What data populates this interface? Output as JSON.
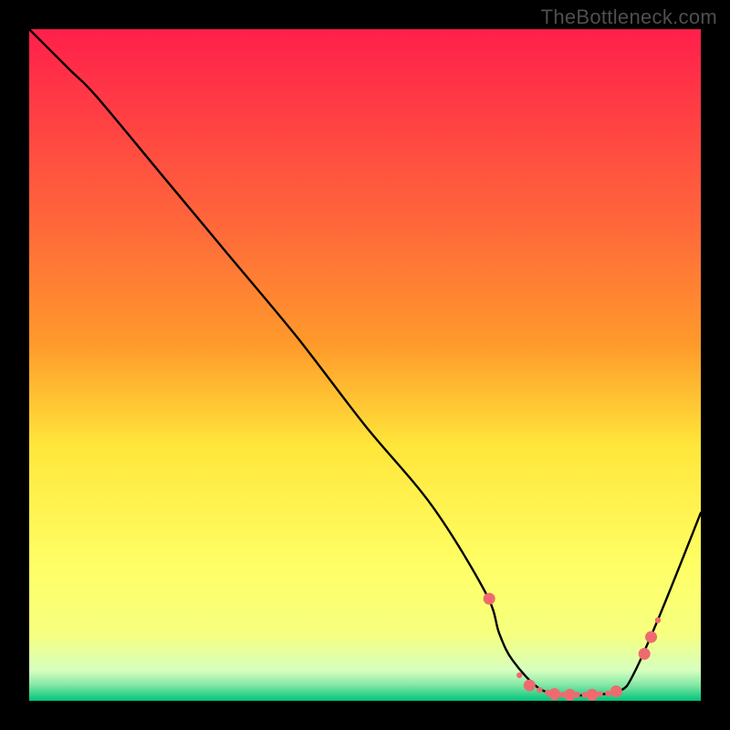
{
  "watermark": "TheBottleneck.com",
  "chart_data": {
    "type": "line",
    "title": "",
    "xlabel": "",
    "ylabel": "",
    "xlim": [
      0,
      100
    ],
    "ylim": [
      0,
      100
    ],
    "grid": false,
    "legend": false,
    "gradient_top": "#ff1f4b",
    "gradient_mid_upper": "#ff9a2b",
    "gradient_mid": "#ffe63a",
    "gradient_mid_lower": "#f6ff7e",
    "gradient_band": "#d6ffbf",
    "gradient_bottom": "#00c47a",
    "series": [
      {
        "name": "curve",
        "color": "#000000",
        "x": [
          0,
          6,
          10,
          20,
          30,
          40,
          50,
          60,
          68,
          70,
          72,
          76,
          80,
          84,
          88,
          90,
          94,
          100
        ],
        "y": [
          100,
          94,
          90,
          78,
          66,
          54,
          41,
          29,
          16,
          10,
          6,
          1.8,
          0.9,
          0.9,
          1.5,
          4,
          13,
          28
        ]
      }
    ],
    "markers": {
      "name": "points",
      "color": "#ef6a6f",
      "radius_major": 6.5,
      "radius_minor": 3.2,
      "points": [
        {
          "x": 68.5,
          "y": 15.2,
          "r": "major"
        },
        {
          "x": 73.0,
          "y": 3.8,
          "r": "minor"
        },
        {
          "x": 74.5,
          "y": 2.3,
          "r": "major"
        },
        {
          "x": 76.0,
          "y": 1.6,
          "r": "minor"
        },
        {
          "x": 77.2,
          "y": 1.2,
          "r": "minor"
        },
        {
          "x": 78.2,
          "y": 1.0,
          "r": "major"
        },
        {
          "x": 79.4,
          "y": 0.9,
          "r": "minor"
        },
        {
          "x": 80.5,
          "y": 0.9,
          "r": "major"
        },
        {
          "x": 81.6,
          "y": 0.9,
          "r": "minor"
        },
        {
          "x": 82.7,
          "y": 0.9,
          "r": "minor"
        },
        {
          "x": 83.8,
          "y": 0.9,
          "r": "major"
        },
        {
          "x": 85.0,
          "y": 1.0,
          "r": "minor"
        },
        {
          "x": 86.2,
          "y": 1.1,
          "r": "minor"
        },
        {
          "x": 87.4,
          "y": 1.4,
          "r": "major"
        },
        {
          "x": 91.6,
          "y": 7.0,
          "r": "major"
        },
        {
          "x": 92.6,
          "y": 9.5,
          "r": "major"
        },
        {
          "x": 93.6,
          "y": 12.0,
          "r": "minor"
        }
      ]
    }
  }
}
